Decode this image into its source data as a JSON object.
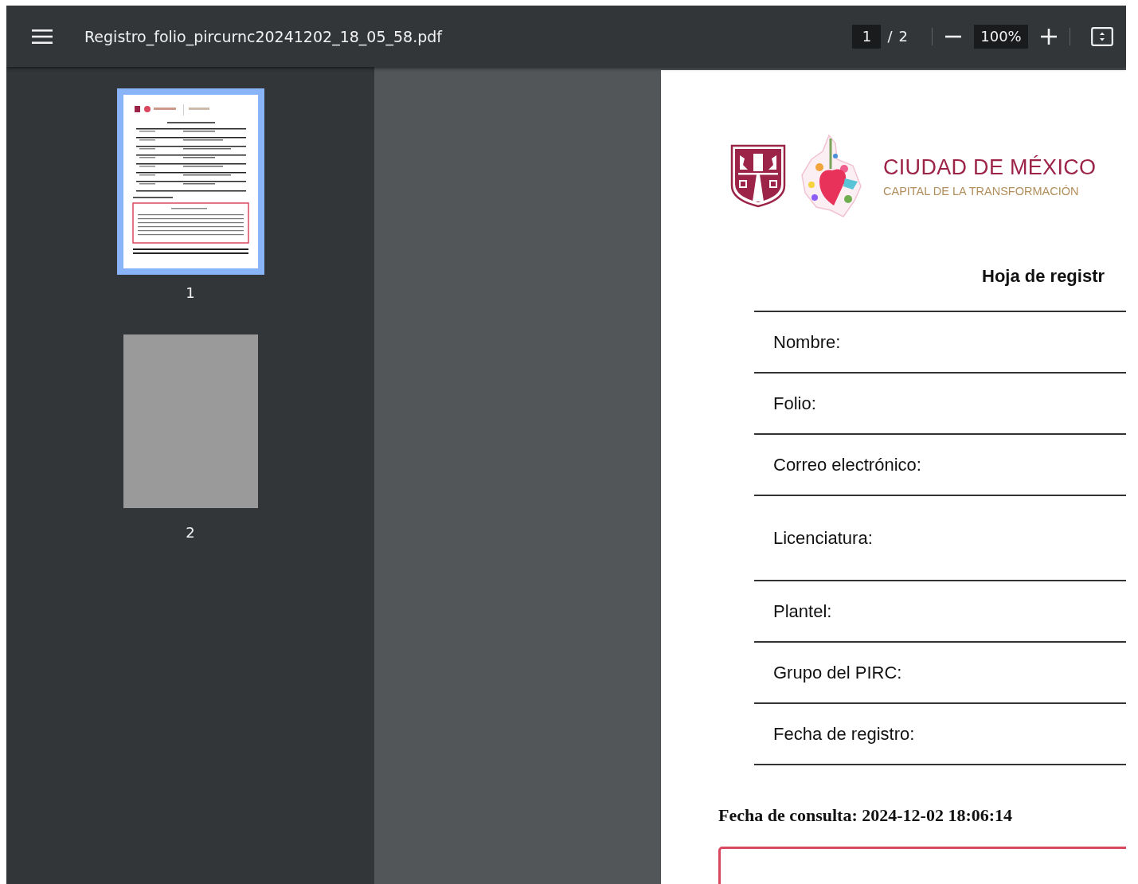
{
  "toolbar": {
    "file_name": "Registro_folio_pircurnc20241202_18_05_58.pdf",
    "page_input": "1",
    "page_separator": "/",
    "page_total": "2",
    "zoom": "100%"
  },
  "thumbnails": [
    {
      "label": "1",
      "selected": true,
      "loaded": true
    },
    {
      "label": "2",
      "selected": false,
      "loaded": false
    }
  ],
  "document": {
    "logo_title": "CIUDAD DE MÉXICO",
    "logo_subtitle": "CAPITAL DE LA TRANSFORMACIÓN",
    "heading": "Hoja de registr",
    "fields": [
      {
        "label": "Nombre:"
      },
      {
        "label": "Folio:"
      },
      {
        "label": "Correo electrónico:"
      },
      {
        "label": "Licenciatura:",
        "kind": "tall"
      },
      {
        "label": "Plantel:"
      },
      {
        "label": "Grupo del PIRC:"
      },
      {
        "label": "Fecha de registro:"
      }
    ],
    "consultation": "Fecha de consulta: 2024-12-02 18:06:14"
  }
}
